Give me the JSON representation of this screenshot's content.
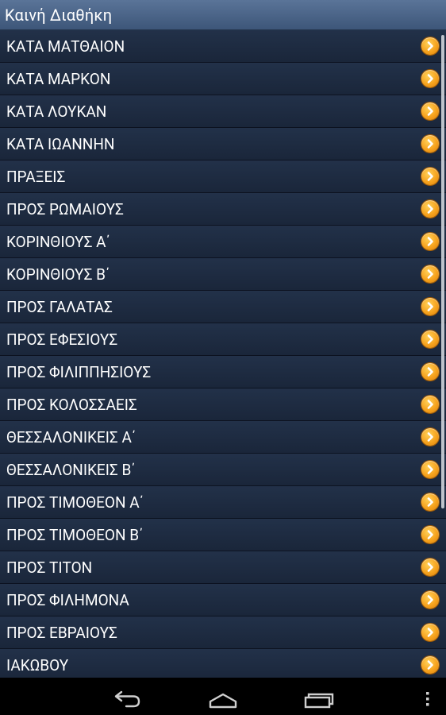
{
  "app": {
    "title": "Καινή Διαθήκη"
  },
  "books": [
    {
      "label": "ΚΑΤΑ ΜΑΤΘΑΙΟΝ"
    },
    {
      "label": "ΚΑΤΑ ΜΑΡΚΟΝ"
    },
    {
      "label": "ΚΑΤΑ ΛΟΥΚΑΝ"
    },
    {
      "label": "ΚΑΤΑ ΙΩΑΝΝΗΝ"
    },
    {
      "label": "ΠΡΑΞΕΙΣ"
    },
    {
      "label": "ΠΡΟΣ ΡΩΜΑΙΟΥΣ"
    },
    {
      "label": "ΚΟΡΙΝΘΙΟΥΣ Α΄"
    },
    {
      "label": "ΚΟΡΙΝΘΙΟΥΣ Β΄"
    },
    {
      "label": "ΠΡΟΣ ΓΑΛΑΤΑΣ"
    },
    {
      "label": "ΠΡΟΣ ΕΦΕΣΙΟΥΣ"
    },
    {
      "label": "ΠΡΟΣ ΦΙΛΙΠΠΗΣΙΟΥΣ"
    },
    {
      "label": "ΠΡΟΣ ΚΟΛΟΣΣΑΕΙΣ"
    },
    {
      "label": "ΘΕΣΣΑΛΟΝΙΚΕΙΣ Α΄"
    },
    {
      "label": "ΘΕΣΣΑΛΟΝΙΚΕΙΣ Β΄"
    },
    {
      "label": "ΠΡΟΣ ΤΙΜΟΘΕΟΝ Α΄"
    },
    {
      "label": "ΠΡΟΣ ΤΙΜΟΘΕΟΝ Β΄"
    },
    {
      "label": "ΠΡΟΣ ΤΙΤΟΝ"
    },
    {
      "label": "ΠΡΟΣ ΦΙΛΗΜΟΝΑ"
    },
    {
      "label": "ΠΡΟΣ ΕΒΡΑΙΟΥΣ"
    },
    {
      "label": "ΙΑΚΩΒΟΥ"
    }
  ],
  "icons": {
    "row_action": "chevron-right-circle-icon",
    "nav_back": "back-icon",
    "nav_home": "home-icon",
    "nav_recents": "recent-apps-icon",
    "nav_menu": "menu-icon"
  },
  "colors": {
    "titlebar": "#4a6389",
    "list_background": "#1d2a40",
    "row_text": "#ffffff",
    "accent_orange": "#f6a21d"
  }
}
